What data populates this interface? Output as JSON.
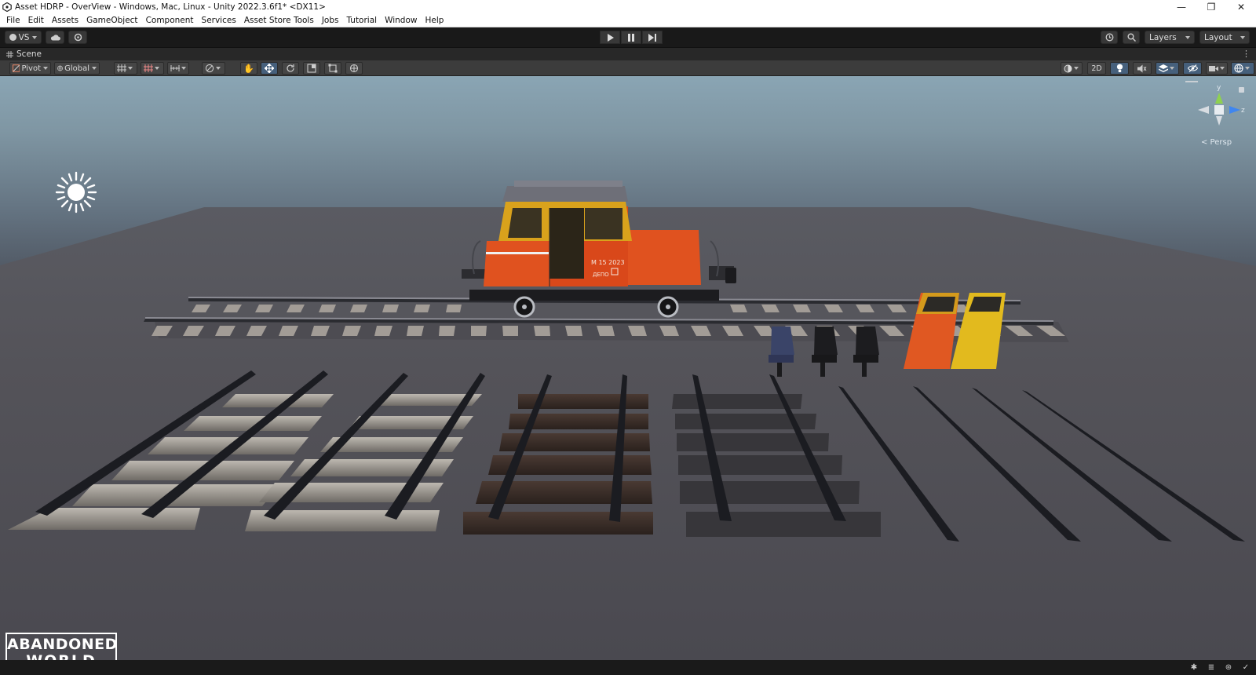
{
  "window": {
    "title": "Asset HDRP - OverView - Windows, Mac, Linux - Unity 2022.3.6f1* <DX11>",
    "controls": [
      "—",
      "❐",
      "✕"
    ]
  },
  "menu": [
    "File",
    "Edit",
    "Assets",
    "GameObject",
    "Component",
    "Services",
    "Asset Store Tools",
    "Jobs",
    "Tutorial",
    "Window",
    "Help"
  ],
  "toolbar": {
    "account_label": "VS",
    "layers_label": "Layers",
    "layout_label": "Layout"
  },
  "scene_tab": {
    "label": "Scene"
  },
  "scene_toolbar": {
    "pivot_label": "Pivot",
    "global_label": "Global",
    "mode_2d_label": "2D"
  },
  "viewport": {
    "gizmo_y_label": "y",
    "gizmo_z_label": "z",
    "projection_label": "< Persp",
    "locomotive_text_1": "M 15 2023",
    "locomotive_text_2": "ДЕПО",
    "watermark_line1": "ABANDONED",
    "watermark_line2": "- WORLD -"
  },
  "colors": {
    "loco_body": "#e0521f",
    "loco_cab_frame": "#d9a21c",
    "door_orange": "#e05822",
    "door_yellow": "#e2ba1e",
    "active_tool": "#46607c"
  }
}
